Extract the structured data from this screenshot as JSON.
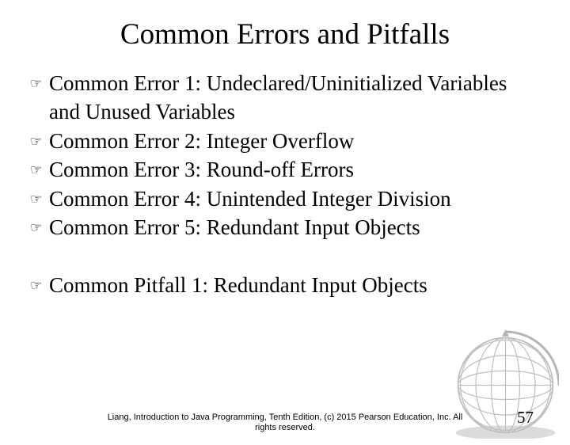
{
  "title": "Common Errors and Pitfalls",
  "errors": [
    "Common Error 1: Undeclared/Uninitialized Variables and Unused Variables",
    "Common Error 2: Integer Overflow",
    "Common Error 3: Round-off Errors",
    "Common Error 4: Unintended Integer Division",
    "Common Error 5: Redundant Input Objects"
  ],
  "pitfalls": [
    "Common Pitfall 1: Redundant Input Objects"
  ],
  "footer": {
    "line1": "Liang, Introduction to Java Programming, Tenth Edition, (c) 2015 Pearson Education, Inc. All",
    "line2": "rights reserved."
  },
  "page_number": "57"
}
